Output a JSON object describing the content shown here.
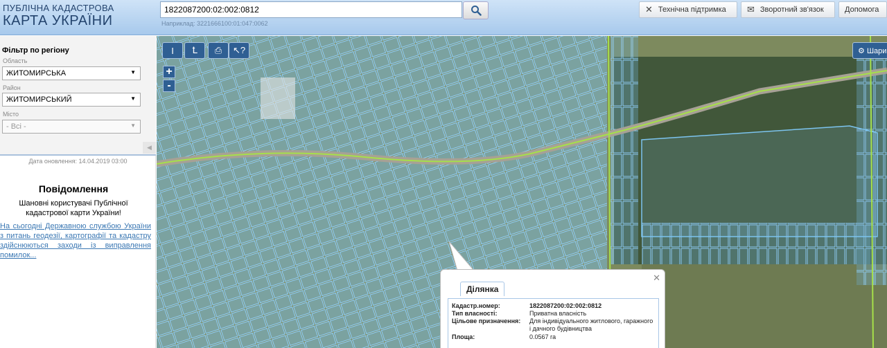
{
  "header": {
    "logo_line1": "ПУБЛІЧНА КАДАСТРОВА",
    "logo_line2": "КАРТА УКРАЇНИ",
    "search_value": "1822087200:02:002:0812",
    "search_hint": "Наприклад: 3221666100:01:047:0062",
    "btn_support": "Технічна підтримка",
    "btn_feedback": "Зворотний зв'язок",
    "btn_help": "Допомога"
  },
  "sidebar": {
    "filter_title": "Фільтр по регіону",
    "oblast_label": "Область",
    "oblast_value": "ЖИТОМИРСЬКА",
    "raion_label": "Район",
    "raion_value": "ЖИТОМИРСЬКИЙ",
    "misto_label": "Місто",
    "misto_value": "- Всі -",
    "update_date": "Дата оновлення: 14.04.2019 03:00",
    "msg_title": "Повідомлення",
    "msg_text": "Шановні користувачі Публічної кадастрової карти України!",
    "msg_link": "На сьогодні Державною службою України з питань геодезії, картографії та кадастру здійснюються заходи із виправлення помилок..."
  },
  "map": {
    "tool_ruler": "I",
    "tool_area": "Ꝉ",
    "zoom_in": "+",
    "zoom_out": "-",
    "layers_btn": "Шари"
  },
  "popup": {
    "tab": "Ділянка",
    "rows": [
      {
        "label": "Кадастр.номер:",
        "value": "1822087200:02:002:0812"
      },
      {
        "label": "Тип власності:",
        "value": "Приватна власність"
      },
      {
        "label": "Цільове призначення:",
        "value": "Для індивідуального житлового, гаражного і дачного будівництва"
      },
      {
        "label": "Площа:",
        "value": "0.0567 га"
      }
    ]
  }
}
